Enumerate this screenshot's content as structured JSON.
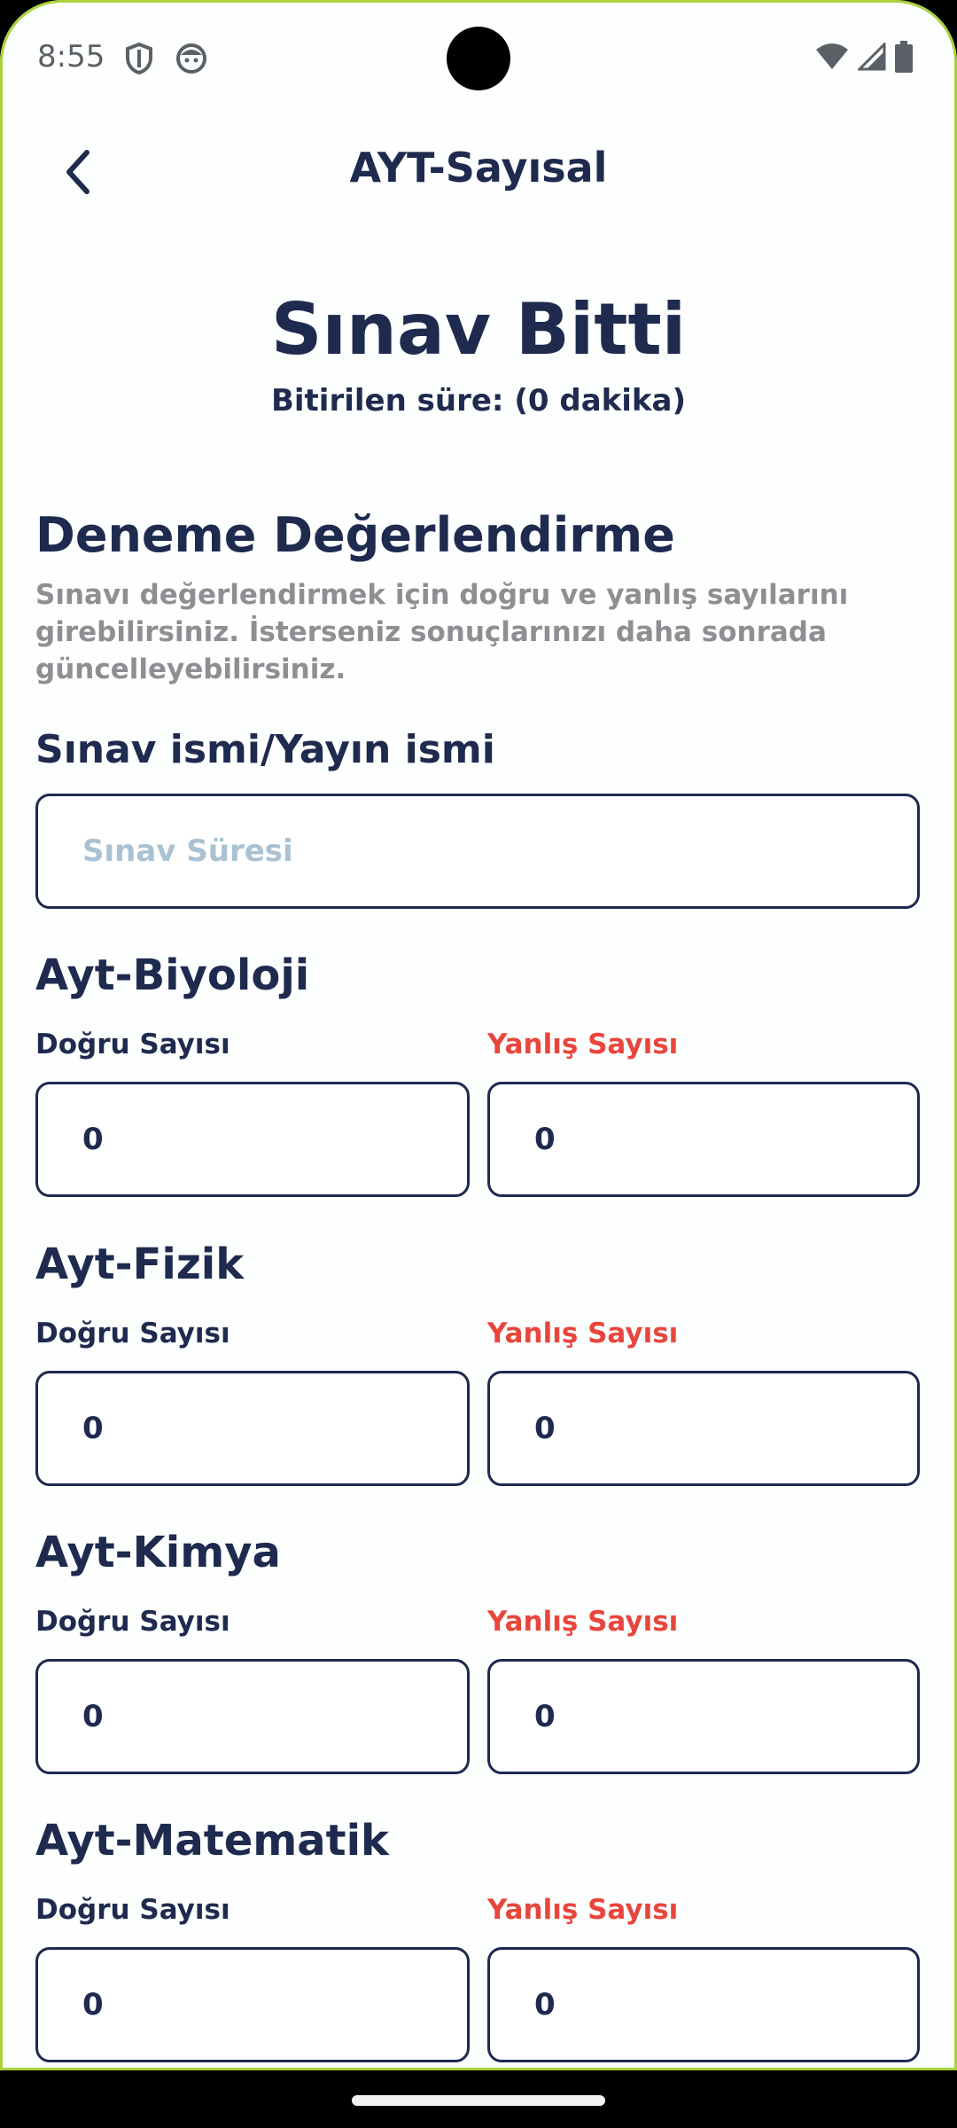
{
  "status_bar": {
    "time": "8:55"
  },
  "app_bar": {
    "title": "AYT-Sayısal"
  },
  "result": {
    "title": "Sınav Bitti",
    "elapsed": "Bitirilen süre: (0 dakika)"
  },
  "evaluation": {
    "title": "Deneme Değerlendirme",
    "description": "Sınavı değerlendirmek için doğru ve yanlış sayılarını girebilirsiniz. İsterseniz  sonuçlarınızı daha sonrada güncelleyebilirsiniz."
  },
  "exam_name": {
    "label": "Sınav ismi/Yayın ismi",
    "placeholder": "Sınav Süresi",
    "value": ""
  },
  "subjects": [
    {
      "name": "Ayt-Biyoloji",
      "correct_label": "Doğru Sayısı",
      "wrong_label": "Yanlış Sayısı",
      "correct_value": "0",
      "wrong_value": "0"
    },
    {
      "name": "Ayt-Fizik",
      "correct_label": "Doğru Sayısı",
      "wrong_label": "Yanlış Sayısı",
      "correct_value": "0",
      "wrong_value": "0"
    },
    {
      "name": "Ayt-Kimya",
      "correct_label": "Doğru Sayısı",
      "wrong_label": "Yanlış Sayısı",
      "correct_value": "0",
      "wrong_value": "0"
    },
    {
      "name": "Ayt-Matematik",
      "correct_label": "Doğru Sayısı",
      "wrong_label": "Yanlış Sayısı",
      "correct_value": "0",
      "wrong_value": "0"
    }
  ],
  "colors": {
    "primary": "#1e2a4e",
    "wrong": "#e8453c",
    "placeholder": "#a9c2d3",
    "muted": "#8e8e93"
  },
  "icons": {
    "status": [
      "shield-icon",
      "face-icon",
      "wifi-icon",
      "signal-icon",
      "battery-icon"
    ],
    "back": "chevron-left-icon"
  }
}
